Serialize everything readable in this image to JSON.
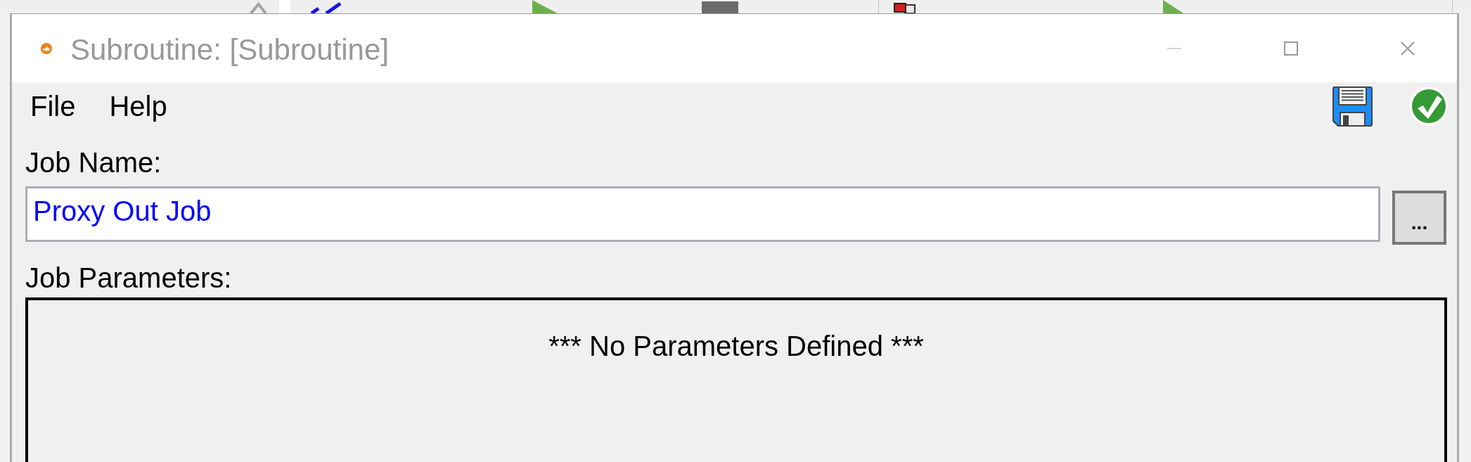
{
  "window": {
    "title": "Subroutine: [Subroutine]",
    "minimize_disabled": true
  },
  "menu": [
    {
      "label": "File"
    },
    {
      "label": "Help"
    }
  ],
  "job_name": {
    "label": "Job Name:",
    "value": "Proxy Out Job",
    "button_label": "..."
  },
  "job_parameters": {
    "label": "Job Parameters:",
    "empty_message": "*** No Parameters Defined ***"
  }
}
